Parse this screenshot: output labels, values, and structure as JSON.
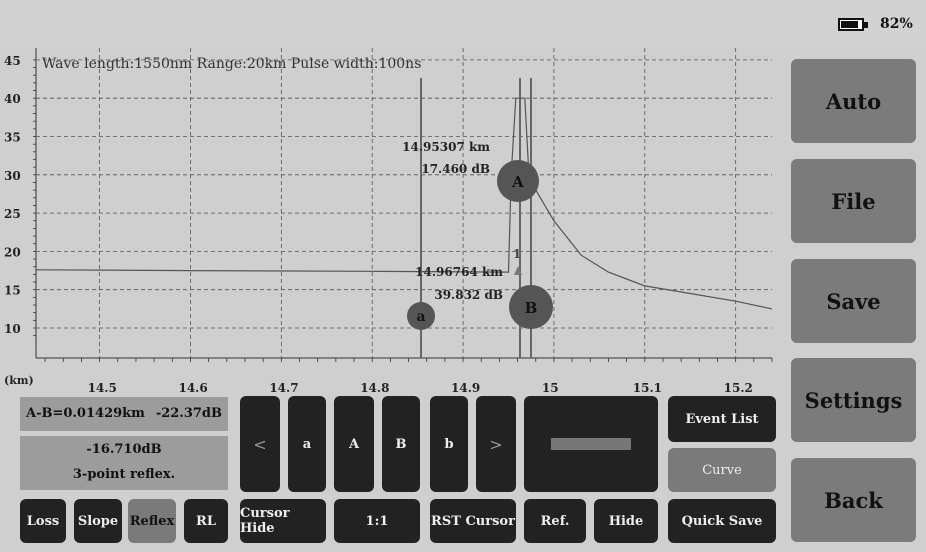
{
  "status": {
    "battery_percent": "82%",
    "battery_level": 0.82
  },
  "plot": {
    "header": "Wave length:1550nm  Range:20km  Pulse width:100ns",
    "y_ticks": [
      "45",
      "40",
      "35",
      "30",
      "25",
      "20",
      "15",
      "10"
    ],
    "x_unit": "(km)",
    "x_ticks": [
      "14.5",
      "14.6",
      "14.7",
      "14.8",
      "14.9",
      "15",
      "15.1",
      "15.2"
    ],
    "cursor_A": {
      "label": "A",
      "distance": "14.95307 km",
      "loss": "17.460 dB"
    },
    "cursor_B": {
      "label": "B",
      "distance": "14.96764 km",
      "loss": "39.832 dB"
    },
    "cursor_a": {
      "label": "a"
    },
    "event_marker": "1"
  },
  "chart_data": {
    "type": "line",
    "xlabel": "(km)",
    "ylabel": "",
    "xlim": [
      14.43,
      15.24
    ],
    "ylim": [
      7,
      46
    ],
    "series": [
      {
        "x": [
          14.43,
          14.6,
          14.8,
          14.95,
          14.953,
          14.958,
          14.962,
          14.968,
          14.972,
          14.98,
          15.0,
          15.03,
          15.06,
          15.1,
          15.15,
          15.2,
          15.24
        ],
        "y": [
          17.6,
          17.5,
          17.4,
          17.3,
          30,
          40,
          40,
          40,
          31,
          28,
          24,
          19.5,
          17.3,
          15.5,
          14.5,
          13.5,
          12.5
        ]
      }
    ]
  },
  "measurements": {
    "ab_distance": "A-B=0.01429km",
    "ab_loss": "-22.37dB",
    "value": "-16.710dB",
    "method": "3-point reflex."
  },
  "cursor_buttons": [
    "<",
    "a",
    "A",
    "B",
    "b",
    ">"
  ],
  "side_buttons": {
    "auto": "Auto",
    "file": "File",
    "save": "Save",
    "settings": "Settings",
    "back": "Back"
  },
  "view_buttons": {
    "event_list": "Event List",
    "curve": "Curve"
  },
  "bottom_buttons": {
    "loss": "Loss",
    "slope": "Slope",
    "reflex": "Reflex",
    "rl": "RL",
    "cursor_hide": "Cursor Hide",
    "ratio": "1:1",
    "rst_cursor": "RST Cursor",
    "ref": "Ref.",
    "hide": "Hide",
    "quick_save": "Quick Save"
  }
}
